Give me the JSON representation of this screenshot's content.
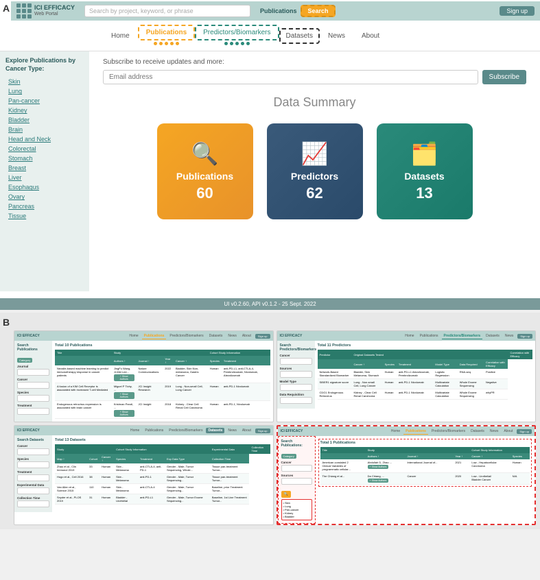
{
  "section_a_label": "A",
  "section_b_label": "B",
  "top_bar": {
    "logo_name": "ICI EFFICACY",
    "logo_sub": "Web Portal",
    "search_placeholder": "Search by project, keyword, or phrase",
    "publications_label": "Publications",
    "search_btn": "Search",
    "signup_btn": "Sign up"
  },
  "nav": {
    "home": "Home",
    "publications": "Publications",
    "predictors_biomarkers": "Predictors/Biomarkers",
    "datasets": "Datasets",
    "news": "News",
    "about": "About"
  },
  "sidebar": {
    "title": "Explore Publications by Cancer Type:",
    "items": [
      "Skin",
      "Lung",
      "Pan-cancer",
      "Kidney",
      "Bladder",
      "Brain",
      "Head and Neck",
      "Colorectal",
      "Stomach",
      "Breast",
      "Liver",
      "Esophagus",
      "Ovary",
      "Pancreas",
      "Tissue"
    ]
  },
  "subscribe": {
    "text": "Subscribe to receive updates and more:",
    "placeholder": "Email address",
    "btn": "Subscribe"
  },
  "data_summary": {
    "title": "Data Summary",
    "cards": [
      {
        "label": "Publications",
        "number": "60",
        "icon": "🔍"
      },
      {
        "label": "Predictors",
        "number": "62",
        "icon": "📈"
      },
      {
        "label": "Datasets",
        "number": "13",
        "icon": "🗂️"
      }
    ]
  },
  "footer": {
    "text": "UI v0.2.60, API v0.1.2 - 25 Sept. 2022"
  },
  "mini_screens": {
    "publications_table": {
      "title": "Total 10 Publications",
      "columns": [
        "Title",
        "Study",
        "Cohort Study Information"
      ],
      "sub_columns": [
        "Authors ↑",
        "Journal ↑",
        "Year ↑",
        "Cancer ↑",
        "Species",
        "Treatment"
      ],
      "rows": [
        [
          "Neosite-based machine...",
          "Ju-Wei Wang...",
          "Nature...",
          "2022",
          "Bladder, Skin...",
          "Human",
          "anti-PD-L1..."
        ],
        [
          "A fusion of a KIM Cell...",
          "Miguel P Tichy...",
          "JCI Insight...",
          "2019",
          "Lung - Non-small Cell...",
          "Human",
          "anti-PD-1..."
        ],
        [
          "Endogenous retrovirus...",
          "Krishnan Pandi...",
          "JCI Insight",
          "2018",
          "Kidney - Clear Cell...",
          "Human",
          "anti-PD-1..."
        ]
      ]
    },
    "predictors_table": {
      "title": "Total 11 Predictors",
      "columns": [
        "Predictor",
        "Original Datasets Tested"
      ],
      "sub_columns": [
        "Cancer ↑",
        "Species",
        "Treatment",
        "Model Type",
        "Data Required",
        "Correlation with Efficacy"
      ],
      "rows": [
        [
          "Network-Based Standardized...",
          "Bladder, Skin...",
          "Human",
          "anti-PD-L1...",
          "Logistic Regression",
          "RNA-seq",
          "Positive"
        ],
        [
          "SIBER1 signature...",
          "Lung - Non-small Cell...",
          "Human",
          "anti-PD-1...",
          "Multivariate...",
          "Whole Exome...",
          "Negative"
        ],
        [
          "CDG1 Endogenous...",
          "Kidney - Clear Cell...",
          "Human",
          "anti-PD-1...",
          "Multivariate...",
          "Whole Exome...",
          "whyPR"
        ]
      ]
    },
    "datasets_table": {
      "title": "Total 13 Datasets",
      "columns": [
        "Study",
        "Cohort Study Information",
        "Experimental Data",
        "Collection Time"
      ]
    },
    "publications_search": {
      "title": "Total 1 Publications",
      "search_label": "Search Publications: Category"
    }
  }
}
